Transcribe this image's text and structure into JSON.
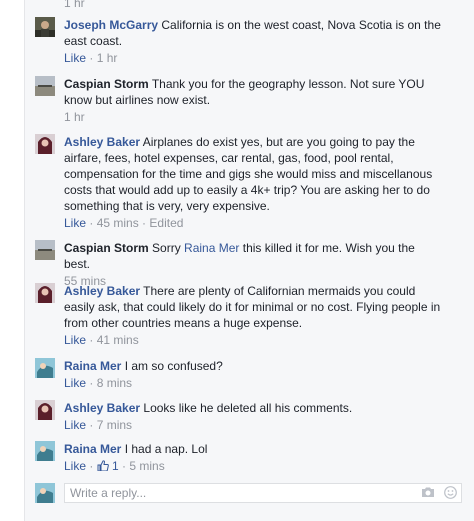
{
  "top_stub": "1 hr",
  "comments": [
    {
      "author": "Joseph McGarry",
      "text": "California is on the west coast, Nova Scotia is on the east coast.",
      "like": "Like",
      "sep": " · ",
      "time": "1 hr"
    },
    {
      "author": "Caspian Storm",
      "text": "Thank you for the geography lesson. Not sure YOU know but airlines now exist.",
      "time": "1 hr"
    },
    {
      "author": "Ashley Baker",
      "text": "Airplanes do exist yes, but are you going to pay the airfare, fees, hotel expenses, car rental, gas, food, pool rental, compensation for the time and gigs she would miss and miscellanous costs that would add up to easily a 4k+ trip? You are asking her to do something that is very, very expensive.",
      "like": "Like",
      "sep": " · ",
      "time": "45 mins",
      "edited": "Edited"
    },
    {
      "author": "Caspian Storm",
      "text_before": "Sorry ",
      "mention": "Raina Mer",
      "text_after": " this killed it for me. Wish you the best.",
      "time": "55 mins"
    },
    {
      "author": "Ashley Baker",
      "text": "There are plenty of Californian mermaids you could easily ask, that could likely do it for minimal or no cost. Flying people in from other countries means a huge expense.",
      "like": "Like",
      "sep": " · ",
      "time": "41 mins"
    },
    {
      "author": "Raina Mer",
      "text": "I am so confused?",
      "like": "Like",
      "sep": " · ",
      "time": "8 mins"
    },
    {
      "author": "Ashley Baker",
      "text": "Looks like he deleted all his comments.",
      "like": "Like",
      "sep": " · ",
      "time": "7 mins"
    },
    {
      "author": "Raina Mer",
      "text": "I had a nap. Lol",
      "like": "Like",
      "sep": " · ",
      "like_count": "1",
      "time": "5 mins"
    }
  ],
  "reply": {
    "placeholder": "Write a reply..."
  },
  "colors": {
    "link": "#365899",
    "muted": "#90949c",
    "text": "#1d2129",
    "thread_bg": "#f6f7f9"
  },
  "icons": [
    "avatar-joseph",
    "avatar-caspian",
    "avatar-ashley",
    "avatar-raina",
    "thumbs-up-icon",
    "camera-icon",
    "smiley-icon"
  ]
}
